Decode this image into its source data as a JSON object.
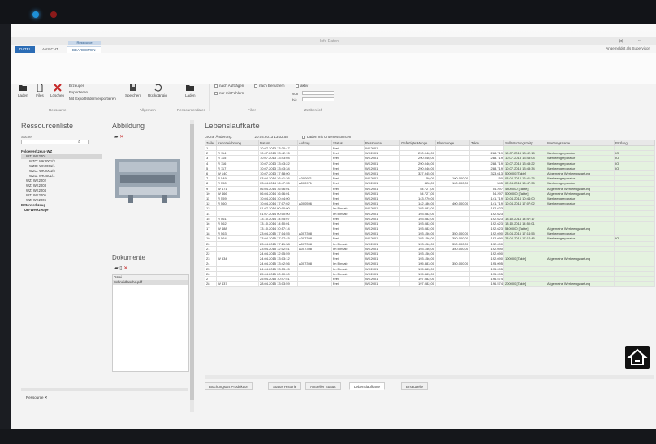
{
  "window": {
    "title": "Info Daten",
    "user": "Angemeldet als Supervisor",
    "context_tab": "Ressource"
  },
  "tabs": [
    "DATEI",
    "ANSICHT",
    "BEARBEITEN"
  ],
  "ribbon": {
    "load": "Laden",
    "files": "Files",
    "delete": "Löschen",
    "create": "Erzeugen",
    "export": "Exportieren",
    "export_all": "Mit Exportfeldern exportieren",
    "save": "Speichern",
    "undo": "Rückgängig",
    "load2": "Laden",
    "by_orders": "nach Aufträgen",
    "only_errors": "nur mit Fehlern",
    "by_users": "nach Benutzern",
    "active": "aktiv",
    "from": "von",
    "to": "bis",
    "groups": [
      "Ressource",
      "Allgemein",
      "Ressourcendaten",
      "Filter",
      "Zeitbereich"
    ]
  },
  "left": {
    "title": "Ressourcenliste",
    "search_label": "Suche",
    "tree": [
      "Folgewerkzeug-WZ",
      "WZ: WK2001",
      "WZO: WK2001/3",
      "WZO: WK2001/1",
      "WZO: WK2001/5",
      "WZU: WK2001/1",
      "WZ: WK2002",
      "WZ: WK2003",
      "WZ: WK2004",
      "WZ: WK2005",
      "WZ: WK2006",
      "Bitterwerkzeug",
      "UB-Werkzeuge"
    ],
    "bottom_tab": "Ressource"
  },
  "middle": {
    "image_title": "Abbildung",
    "docs_title": "Dokumente",
    "doc_header": "Datei",
    "doc_file": "Schneidlasche.pdf"
  },
  "right": {
    "title": "Lebenslaufkarte",
    "last_change_label": "Letzte Änderung:",
    "last_change": "20.04.2013 13:02:58",
    "sub_label": "Laden mit Unterressourcen",
    "columns": [
      "Zeile",
      "Kennzeichnung",
      "Datum",
      "Auftrag",
      "Status",
      "Ressource",
      "Gefertigte Menge",
      "Planmenge",
      "Takte",
      "Soll Wartungszeitp...",
      "Wartungsname",
      "Prüfung"
    ],
    "rows": [
      [
        "1",
        "",
        "10.07.2013 13:30:47",
        "",
        "Frei",
        "WK2001",
        "",
        "",
        "",
        "",
        "",
        ""
      ],
      [
        "2",
        "R 114",
        "10.07.2013 13:42:15",
        "",
        "Frei",
        "WK2001",
        "290.046,00",
        "",
        "288.719",
        "10.07.2013 13:42:15",
        "Werkzeugreparatur",
        "IO"
      ],
      [
        "3",
        "R 115",
        "10.07.2013 13:43:04",
        "",
        "Frei",
        "WK2001",
        "290.046,00",
        "",
        "288.719",
        "10.07.2013 13:43:04",
        "Werkzeugreparatur",
        "IO"
      ],
      [
        "4",
        "R 116",
        "10.07.2013 13:43:22",
        "",
        "Frei",
        "WK2001",
        "290.046,00",
        "",
        "288.719",
        "10.07.2013 13:43:22",
        "Werkzeugreparatur",
        "IO"
      ],
      [
        "5",
        "R 117",
        "10.07.2013 13:43:34",
        "",
        "Frei",
        "WK2001",
        "290.046,00",
        "",
        "288.719",
        "10.07.2013 13:43:34",
        "Werkzeugreparatur",
        "IO"
      ],
      [
        "6",
        "W 140",
        "10.07.2013 17:58:00",
        "",
        "Frei",
        "WK2001",
        "327.945,00",
        "",
        "323.613",
        "500000 [Takte]",
        "Allgemeine Werkzeugwartung",
        ""
      ],
      [
        "7",
        "R 549",
        "03.04.2014 16:41:26",
        "A000971",
        "Frei",
        "WK2001",
        "50,00",
        "100.000,00",
        "50",
        "03.04.2014 16:41:26",
        "Werkzeugreparatur",
        ""
      ],
      [
        "8",
        "R 550",
        "03.04.2014 16:47:35",
        "A000971",
        "Frei",
        "WK2001",
        "428,00",
        "100.000,00",
        "545",
        "02.04.2014 16:47:35",
        "Werkzeugreparatur",
        ""
      ],
      [
        "9",
        "W 471",
        "06.04.2014 16:06:01",
        "",
        "Frei",
        "WK2001",
        "54.727,00",
        "",
        "54.297",
        "4800000 [Takte]",
        "Allgemeine Werkzeugwartung",
        ""
      ],
      [
        "10",
        "W 466",
        "06.04.2014 16:06:01",
        "",
        "Frei",
        "WK2001",
        "54.727,00",
        "",
        "54.297",
        "5000000 [Takte]",
        "Allgemeine Werkzeugwartung",
        ""
      ],
      [
        "11",
        "R 559",
        "10.04.2014 10:44:00",
        "",
        "Frei",
        "WK2001",
        "143.270,00",
        "",
        "141.719",
        "10.04.2014 10:44:00",
        "Werkzeugreparatur",
        ""
      ],
      [
        "12",
        "R 560",
        "10.04.2014 17:07:02",
        "A000596",
        "Frei",
        "WK2001",
        "142.186,00",
        "400.000,00",
        "141.719",
        "10.04.2014 17:07:02",
        "Werkzeugreparatur",
        ""
      ],
      [
        "13",
        "",
        "01.07.2014 00:00:00",
        "",
        "Im Einsatz",
        "WK2001",
        "193.082,00",
        "",
        "192.623",
        "",
        "",
        ""
      ],
      [
        "14",
        "",
        "01.07.2014 00:00:00",
        "",
        "Im Einsatz",
        "WK2001",
        "193.082,00",
        "",
        "192.623",
        "",
        "",
        ""
      ],
      [
        "15",
        "R 561",
        "13.10.2014 14:45:07",
        "",
        "Frei",
        "WK2001",
        "193.082,00",
        "",
        "192.623",
        "13.10.2014 14:47:17",
        "",
        ""
      ],
      [
        "16",
        "R 562",
        "13.10.2014 14:50:01",
        "",
        "Frei",
        "WK2001",
        "193.082,00",
        "",
        "192.623",
        "13.10.2014 14:50:01",
        "",
        ""
      ],
      [
        "17",
        "W 488",
        "13.10.2014 10:57:14",
        "",
        "Frei",
        "WK2001",
        "193.082,00",
        "",
        "192.623",
        "5400000 [Takte]",
        "Allgemeine Werkzeugwartung",
        ""
      ],
      [
        "18",
        "R 563",
        "23.04.2015 17:14:55",
        "A007398",
        "Frei",
        "WK2001",
        "193.156,00",
        "350.000,00",
        "192.690",
        "23.04.2015 17:14:55",
        "Werkzeugreparatur",
        ""
      ],
      [
        "19",
        "R 564",
        "23.04.2015 17:17:45",
        "A007398",
        "Frei",
        "WK2001",
        "193.156,00",
        "350.000,00",
        "192.690",
        "23.04.2015 17:17:45",
        "Werkzeugreparatur",
        "IO"
      ],
      [
        "20",
        "",
        "23.04.2015 17:21:38",
        "A007398",
        "Im Einsatz",
        "WK2001",
        "193.156,00",
        "350.000,00",
        "192.690",
        "",
        "",
        ""
      ],
      [
        "21",
        "",
        "23.04.2015 12:02:51",
        "A007398",
        "Im Einsatz",
        "WK2001",
        "193.156,00",
        "350.000,00",
        "192.690",
        "",
        "",
        ""
      ],
      [
        "22",
        "",
        "24.04.2015 12:05:59",
        "",
        "Frei",
        "WK2001",
        "193.156,00",
        "",
        "192.690",
        "",
        "",
        ""
      ],
      [
        "23",
        "W 534",
        "24.04.2015 13:03:12",
        "",
        "Frei",
        "WK2001",
        "193.156,00",
        "",
        "192.690",
        "100000 [Takte]",
        "Allgemeine Werkzeugwartung",
        ""
      ],
      [
        "24",
        "",
        "24.04.2015 13:42:56",
        "A007398",
        "Im Einsatz",
        "WK2001",
        "195.383,00",
        "350.000,00",
        "195.095",
        "",
        "",
        ""
      ],
      [
        "25",
        "",
        "24.04.2015 13:53:45",
        "",
        "Im Einsatz",
        "WK2001",
        "195.383,00",
        "",
        "195.095",
        "",
        "",
        ""
      ],
      [
        "26",
        "",
        "25.04.2015 00:00:00",
        "",
        "Im Einsatz",
        "WK2001",
        "195.383,00",
        "",
        "195.095",
        "",
        "",
        ""
      ],
      [
        "27",
        "",
        "25.04.2015 10:47:51",
        "",
        "Frei",
        "WK2001",
        "197.082,00",
        "",
        "196.574",
        "",
        "",
        ""
      ],
      [
        "28",
        "W 437",
        "28.04.2015 13:03:59",
        "",
        "Frei",
        "WK2001",
        "197.082,00",
        "",
        "196.574",
        "200000 [Takte]",
        "Allgemeine Werkzeugwartung",
        ""
      ]
    ],
    "bottom_tabs": [
      "Buchungsart Produktion",
      "Status Historie",
      "Aktueller Status",
      "Lebenslaufkarte",
      "Ersatzteile"
    ]
  }
}
